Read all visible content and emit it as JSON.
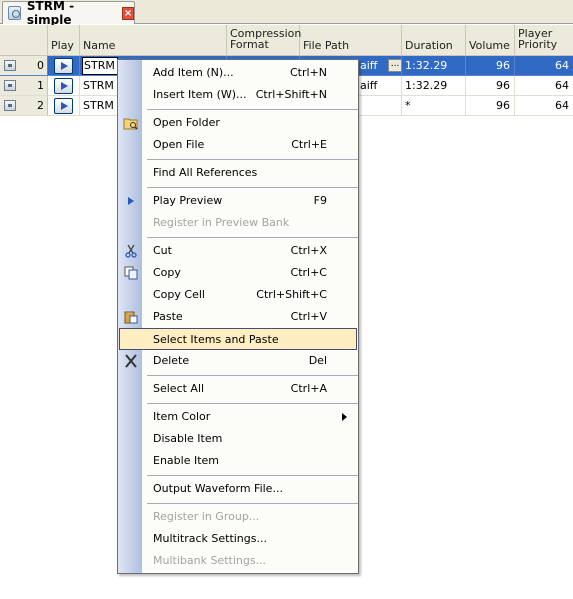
{
  "tab": {
    "title": "STRM - simple",
    "close_label": "×"
  },
  "grid": {
    "columns": [
      {
        "key": "play",
        "label": "Play"
      },
      {
        "key": "name",
        "label": "Name"
      },
      {
        "key": "compression",
        "label": "Compression Format"
      },
      {
        "key": "filepath",
        "label": "File Path"
      },
      {
        "key": "duration",
        "label": "Duration"
      },
      {
        "key": "volume",
        "label": "Volume"
      },
      {
        "key": "priority",
        "label": "Player Priority"
      }
    ],
    "rows": [
      {
        "index": "0",
        "name": "STRM",
        "filepath": "aiff",
        "ellipsis": "...",
        "duration": "1:32.29",
        "volume": "96",
        "priority": "64",
        "selected": true
      },
      {
        "index": "1",
        "name": "STRM",
        "filepath": "aiff",
        "duration": "1:32.29",
        "volume": "96",
        "priority": "64"
      },
      {
        "index": "2",
        "name": "STRM",
        "filepath": "",
        "duration": "*",
        "volume": "96",
        "priority": "64"
      }
    ]
  },
  "menu": {
    "items": [
      {
        "label": "Add Item (N)...",
        "shortcut": "Ctrl+N"
      },
      {
        "label": "Insert Item (W)...",
        "shortcut": "Ctrl+Shift+N"
      },
      {
        "label": "Open Folder",
        "shortcut": ""
      },
      {
        "label": "Open File",
        "shortcut": "Ctrl+E"
      },
      {
        "label": "Find All References",
        "shortcut": ""
      },
      {
        "label": "Play Preview",
        "shortcut": "F9"
      },
      {
        "label": "Register in Preview Bank",
        "shortcut": ""
      },
      {
        "label": "Cut",
        "shortcut": "Ctrl+X"
      },
      {
        "label": "Copy",
        "shortcut": "Ctrl+C"
      },
      {
        "label": "Copy Cell",
        "shortcut": "Ctrl+Shift+C"
      },
      {
        "label": "Paste",
        "shortcut": "Ctrl+V"
      },
      {
        "label": "Select Items and Paste",
        "shortcut": ""
      },
      {
        "label": "Delete",
        "shortcut": "Del"
      },
      {
        "label": "Select All",
        "shortcut": "Ctrl+A"
      },
      {
        "label": "Item Color",
        "shortcut": ""
      },
      {
        "label": "Disable Item",
        "shortcut": ""
      },
      {
        "label": "Enable Item",
        "shortcut": ""
      },
      {
        "label": "Output Waveform File...",
        "shortcut": ""
      },
      {
        "label": "Register in Group...",
        "shortcut": ""
      },
      {
        "label": "Multitrack Settings...",
        "shortcut": ""
      },
      {
        "label": "Multibank Settings...",
        "shortcut": ""
      }
    ]
  },
  "colors": {
    "selection": "#316ac5",
    "menu_hover": "#ffeec2",
    "disabled_text": "#a3a3a3"
  }
}
